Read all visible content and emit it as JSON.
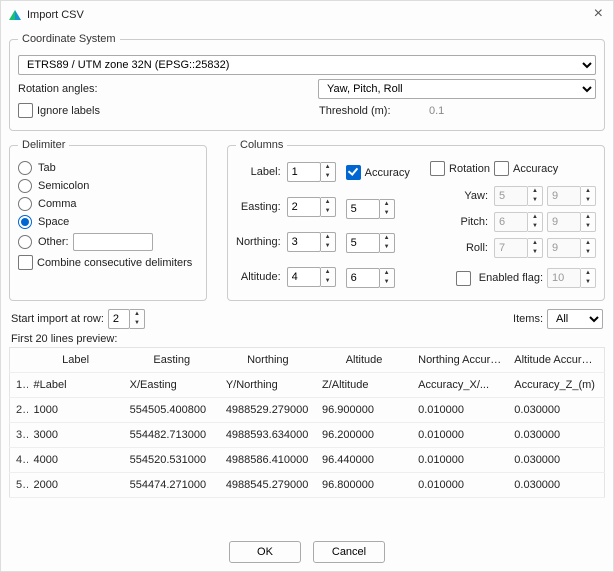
{
  "window": {
    "title": "Import CSV"
  },
  "coord_system": {
    "legend": "Coordinate System",
    "value": "ETRS89 / UTM zone 32N (EPSG::25832)",
    "rotation_label": "Rotation angles:",
    "rotation_value": "Yaw, Pitch, Roll",
    "ignore_labels": "Ignore labels",
    "threshold_label": "Threshold (m):",
    "threshold_value": "0.1"
  },
  "delimiter": {
    "legend": "Delimiter",
    "tab": "Tab",
    "semicolon": "Semicolon",
    "comma": "Comma",
    "space": "Space",
    "other": "Other:",
    "other_value": "",
    "combine": "Combine consecutive delimiters"
  },
  "columns": {
    "legend": "Columns",
    "label_lbl": "Label:",
    "label_val": "1",
    "accuracy_chk": "Accuracy",
    "rotation_chk": "Rotation",
    "accuracy2_chk": "Accuracy",
    "easting_lbl": "Easting:",
    "easting_val": "2",
    "easting_acc": "5",
    "northing_lbl": "Northing:",
    "northing_val": "3",
    "northing_acc": "5",
    "altitude_lbl": "Altitude:",
    "altitude_val": "4",
    "altitude_acc": "6",
    "yaw_lbl": "Yaw:",
    "yaw_v": "5",
    "yaw_a": "9",
    "pitch_lbl": "Pitch:",
    "pitch_v": "6",
    "pitch_a": "9",
    "roll_lbl": "Roll:",
    "roll_v": "7",
    "roll_a": "9",
    "enabled_flag": "Enabled flag:",
    "enabled_v": "10"
  },
  "start_row_lbl": "Start import at row:",
  "start_row_val": "2",
  "items_lbl": "Items:",
  "items_val": "All",
  "preview_lbl": "First 20 lines preview:",
  "headers": {
    "c0": "Label",
    "c1": "Easting",
    "c2": "Northing",
    "c3": "Altitude",
    "c4": "Northing Accuracy",
    "c5": "Altitude Accuracy"
  },
  "rows": {
    "r0": {
      "n": "1",
      "c0": "#Label",
      "c1": "X/Easting",
      "c2": "Y/Northing",
      "c3": "Z/Altitude",
      "c4": "Accuracy_X/...",
      "c5": "Accuracy_Z_(m)"
    },
    "r1": {
      "n": "2",
      "c0": "1000",
      "c1": "554505.400800",
      "c2": "4988529.279000",
      "c3": "96.900000",
      "c4": "0.010000",
      "c5": "0.030000"
    },
    "r2": {
      "n": "3",
      "c0": "3000",
      "c1": "554482.713000",
      "c2": "4988593.634000",
      "c3": "96.200000",
      "c4": "0.010000",
      "c5": "0.030000"
    },
    "r3": {
      "n": "4",
      "c0": "4000",
      "c1": "554520.531000",
      "c2": "4988586.410000",
      "c3": "96.440000",
      "c4": "0.010000",
      "c5": "0.030000"
    },
    "r4": {
      "n": "5",
      "c0": "2000",
      "c1": "554474.271000",
      "c2": "4988545.279000",
      "c3": "96.800000",
      "c4": "0.010000",
      "c5": "0.030000"
    }
  },
  "buttons": {
    "ok": "OK",
    "cancel": "Cancel"
  }
}
